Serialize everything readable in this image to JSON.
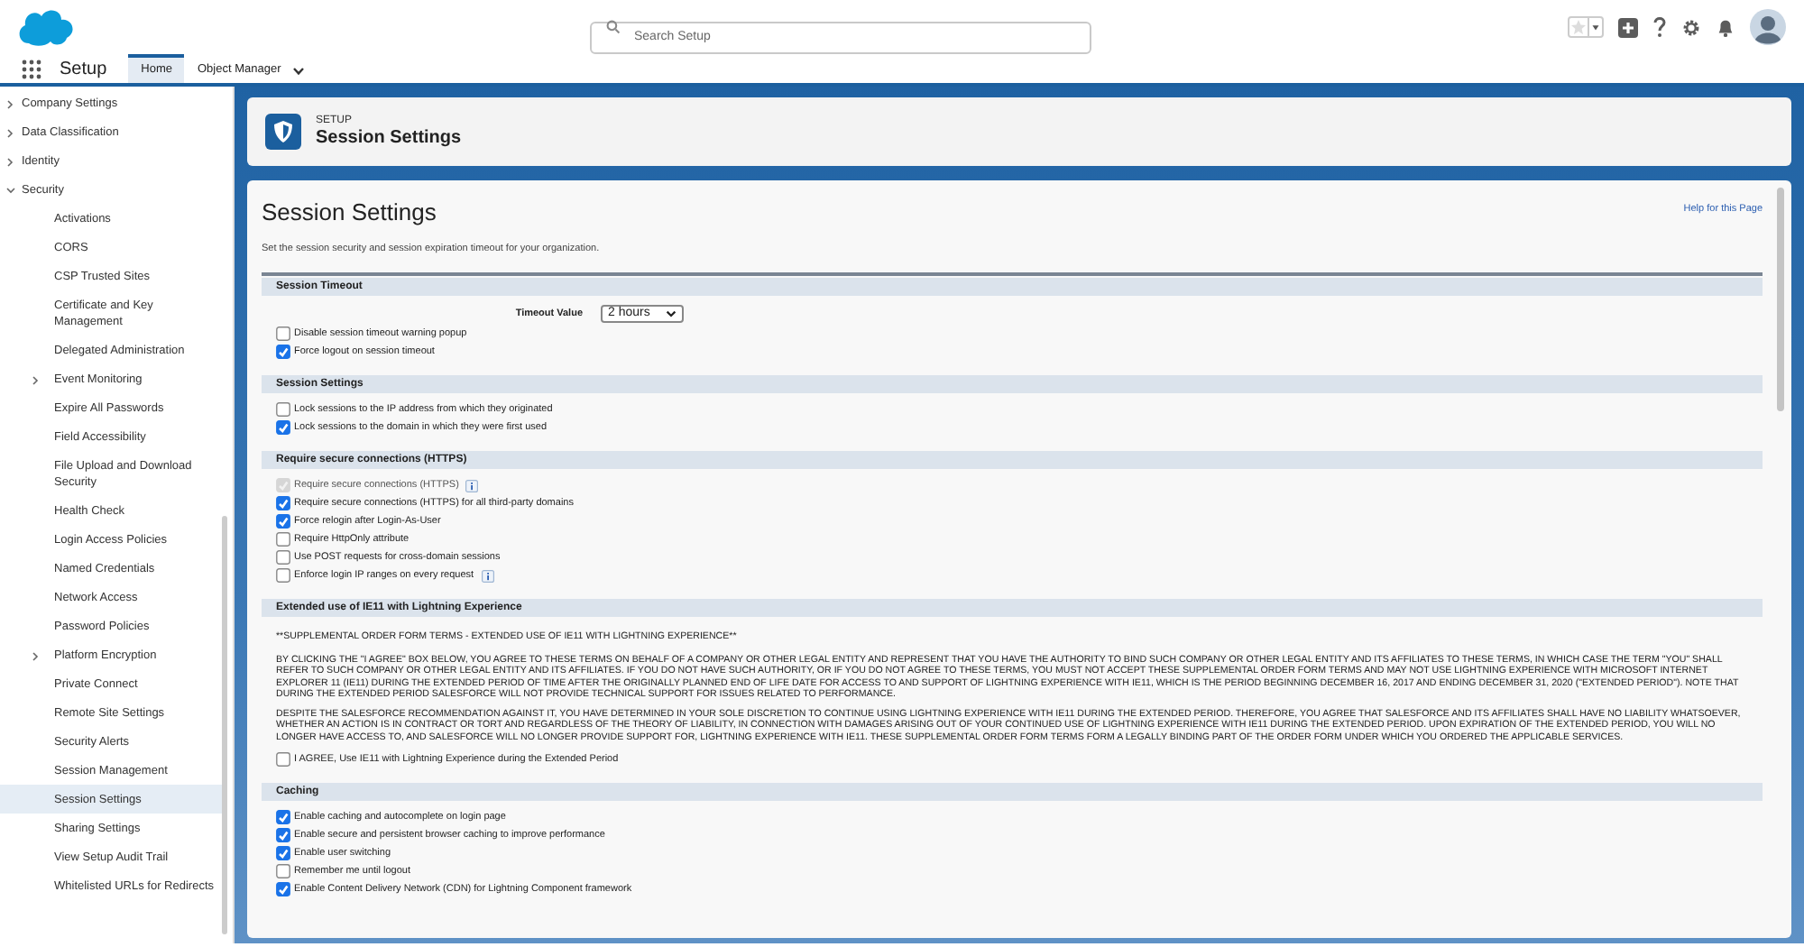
{
  "header": {
    "search": {
      "placeholder": "Search Setup"
    }
  },
  "nav": {
    "app": "Setup",
    "tabs": [
      {
        "label": "Home",
        "selected": true,
        "menu": false
      },
      {
        "label": "Object Manager",
        "selected": false,
        "menu": true
      }
    ]
  },
  "sidebar": {
    "items": [
      {
        "label": "Company Settings",
        "expanded": false,
        "selected": false
      },
      {
        "label": "Data Classification",
        "expanded": false,
        "selected": false
      },
      {
        "label": "Identity",
        "expanded": false,
        "selected": false
      },
      {
        "label": "Security",
        "expanded": true,
        "selected": false,
        "children": [
          {
            "label": "Activations",
            "selected": false
          },
          {
            "label": "CORS",
            "selected": false
          },
          {
            "label": "CSP Trusted Sites",
            "selected": false
          },
          {
            "label": "Certificate and Key Management",
            "selected": false
          },
          {
            "label": "Delegated Administration",
            "selected": false
          },
          {
            "label": "Event Monitoring",
            "expanded": false,
            "selected": false
          },
          {
            "label": "Expire All Passwords",
            "selected": false
          },
          {
            "label": "Field Accessibility",
            "selected": false
          },
          {
            "label": "File Upload and Download Security",
            "selected": false
          },
          {
            "label": "Health Check",
            "selected": false
          },
          {
            "label": "Login Access Policies",
            "selected": false
          },
          {
            "label": "Named Credentials",
            "selected": false
          },
          {
            "label": "Network Access",
            "selected": false
          },
          {
            "label": "Password Policies",
            "selected": false
          },
          {
            "label": "Platform Encryption",
            "expanded": false,
            "selected": false
          },
          {
            "label": "Private Connect",
            "selected": false
          },
          {
            "label": "Remote Site Settings",
            "selected": false
          },
          {
            "label": "Security Alerts",
            "selected": false
          },
          {
            "label": "Session Management",
            "selected": false
          },
          {
            "label": "Session Settings",
            "selected": true
          },
          {
            "label": "Sharing Settings",
            "selected": false
          },
          {
            "label": "View Setup Audit Trail",
            "selected": false
          },
          {
            "label": "Whitelisted URLs for Redirects",
            "selected": false
          }
        ]
      }
    ]
  },
  "page_header": {
    "eyebrow": "SETUP",
    "title": "Session Settings"
  },
  "content": {
    "title": "Session Settings",
    "help_link": "Help for this Page",
    "description": "Set the session security and session expiration timeout for your organization.",
    "sections": [
      {
        "title": "Session Timeout",
        "rows": [
          {
            "kind": "select",
            "label": "Timeout Value",
            "value": "2 hours"
          },
          {
            "kind": "checkbox",
            "label": "Disable session timeout warning popup",
            "checked": false,
            "disabled": false,
            "info": false
          },
          {
            "kind": "checkbox",
            "label": "Force logout on session timeout",
            "checked": true,
            "disabled": false,
            "info": false
          }
        ]
      },
      {
        "title": "Session Settings",
        "rows": [
          {
            "kind": "checkbox",
            "label": "Lock sessions to the IP address from which they originated",
            "checked": false,
            "disabled": false,
            "info": false
          },
          {
            "kind": "checkbox",
            "label": "Lock sessions to the domain in which they were first used",
            "checked": true,
            "disabled": false,
            "info": false
          }
        ]
      },
      {
        "title": "Require secure connections (HTTPS)",
        "rows": [
          {
            "kind": "checkbox",
            "label": "Require secure connections (HTTPS)",
            "checked": true,
            "disabled": true,
            "info": true
          },
          {
            "kind": "checkbox",
            "label": "Require secure connections (HTTPS) for all third-party domains",
            "checked": true,
            "disabled": false,
            "info": false
          },
          {
            "kind": "checkbox",
            "label": "Force relogin after Login-As-User",
            "checked": true,
            "disabled": false,
            "info": false
          },
          {
            "kind": "checkbox",
            "label": "Require HttpOnly attribute",
            "checked": false,
            "disabled": false,
            "info": false
          },
          {
            "kind": "checkbox",
            "label": "Use POST requests for cross-domain sessions",
            "checked": false,
            "disabled": false,
            "info": false
          },
          {
            "kind": "checkbox",
            "label": "Enforce login IP ranges on every request",
            "checked": false,
            "disabled": false,
            "info": true
          }
        ]
      },
      {
        "title": "Extended use of IE11 with Lightning Experience",
        "rows": [
          {
            "kind": "paragraph",
            "text": "**SUPPLEMENTAL ORDER FORM TERMS - EXTENDED USE OF IE11 WITH LIGHTNING EXPERIENCE**"
          },
          {
            "kind": "paragraph",
            "text": "BY CLICKING THE \"I AGREE\" BOX BELOW, YOU AGREE TO THESE TERMS ON BEHALF OF A COMPANY OR OTHER LEGAL ENTITY AND REPRESENT THAT YOU HAVE THE AUTHORITY TO BIND SUCH COMPANY OR OTHER LEGAL ENTITY AND ITS AFFILIATES TO THESE TERMS, IN WHICH CASE THE TERM \"YOU\" SHALL REFER TO SUCH COMPANY OR OTHER LEGAL ENTITY AND ITS AFFILIATES. IF YOU DO NOT HAVE SUCH AUTHORITY, OR IF YOU DO NOT AGREE TO THESE TERMS, YOU MUST NOT ACCEPT THESE SUPPLEMENTAL ORDER FORM TERMS AND MAY NOT USE LIGHTNING EXPERIENCE WITH MICROSOFT INTERNET EXPLORER 11 (IE11) DURING THE EXTENDED PERIOD OF TIME AFTER THE ORIGINALLY PLANNED END OF LIFE DATE FOR ACCESS TO AND SUPPORT OF LIGHTNING EXPERIENCE WITH IE11, WHICH IS THE PERIOD BEGINNING DECEMBER 16, 2017 AND ENDING DECEMBER 31, 2020 (\"EXTENDED PERIOD\"). NOTE THAT DURING THE EXTENDED PERIOD SALESFORCE WILL NOT PROVIDE TECHNICAL SUPPORT FOR ISSUES RELATED TO PERFORMANCE."
          },
          {
            "kind": "paragraph",
            "text": "DESPITE THE SALESFORCE RECOMMENDATION AGAINST IT, YOU HAVE DETERMINED IN YOUR SOLE DISCRETION TO CONTINUE USING LIGHTNING EXPERIENCE WITH IE11 DURING THE EXTENDED PERIOD. THEREFORE, YOU AGREE THAT SALESFORCE AND ITS AFFILIATES SHALL HAVE NO LIABILITY WHATSOEVER, WHETHER AN ACTION IS IN CONTRACT OR TORT AND REGARDLESS OF THE THEORY OF LIABILITY, IN CONNECTION WITH DAMAGES ARISING OUT OF YOUR CONTINUED USE OF LIGHTNING EXPERIENCE WITH IE11 DURING THE EXTENDED PERIOD. UPON EXPIRATION OF THE EXTENDED PERIOD, YOU WILL NO LONGER HAVE ACCESS TO, AND SALESFORCE WILL NO LONGER PROVIDE SUPPORT FOR, LIGHTNING EXPERIENCE WITH IE11. THESE SUPPLEMENTAL ORDER FORM TERMS FORM A LEGALLY BINDING PART OF THE ORDER FORM UNDER WHICH YOU ORDERED THE APPLICABLE SERVICES."
          },
          {
            "kind": "checkbox",
            "label": "I AGREE, Use IE11 with Lightning Experience during the Extended Period",
            "checked": false,
            "disabled": false,
            "info": false
          }
        ]
      },
      {
        "title": "Caching",
        "rows": [
          {
            "kind": "checkbox",
            "label": "Enable caching and autocomplete on login page",
            "checked": true,
            "disabled": false,
            "info": false
          },
          {
            "kind": "checkbox",
            "label": "Enable secure and persistent browser caching to improve performance",
            "checked": true,
            "disabled": false,
            "info": false
          },
          {
            "kind": "checkbox",
            "label": "Enable user switching",
            "checked": true,
            "disabled": false,
            "info": false
          },
          {
            "kind": "checkbox",
            "label": "Remember me until logout",
            "checked": false,
            "disabled": false,
            "info": false
          },
          {
            "kind": "checkbox",
            "label": "Enable Content Delivery Network (CDN) for Lightning Component framework",
            "checked": true,
            "disabled": false,
            "info": false
          }
        ]
      }
    ]
  }
}
